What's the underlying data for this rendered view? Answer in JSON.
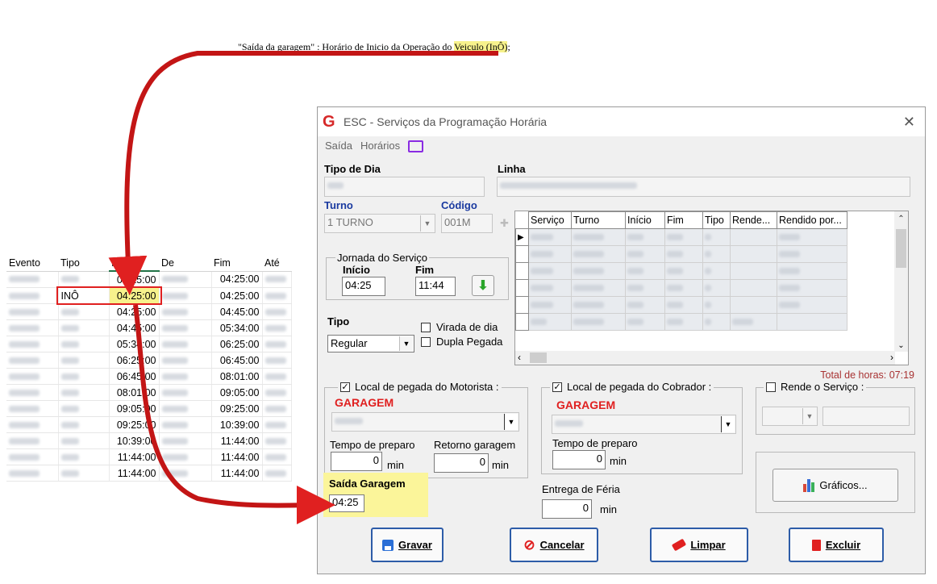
{
  "annotation": {
    "prefix": "\"Saída da garagem\" : Horário de Inicio da Operação do ",
    "highlight": "Veiculo (InÔ)",
    "suffix": ";"
  },
  "sheet": {
    "headers": [
      "Evento",
      "Tipo",
      "Início",
      "De",
      "Fim",
      "Até"
    ],
    "rows": [
      {
        "tipo": "",
        "inicio": "04:25:00",
        "fim": "04:25:00"
      },
      {
        "tipo": "INÔ",
        "inicio": "04:25:00",
        "fim": "04:25:00"
      },
      {
        "tipo": "",
        "inicio": "04:25:00",
        "fim": "04:45:00"
      },
      {
        "tipo": "",
        "inicio": "04:45:00",
        "fim": "05:34:00"
      },
      {
        "tipo": "",
        "inicio": "05:34:00",
        "fim": "06:25:00"
      },
      {
        "tipo": "",
        "inicio": "06:25:00",
        "fim": "06:45:00"
      },
      {
        "tipo": "",
        "inicio": "06:45:00",
        "fim": "08:01:00"
      },
      {
        "tipo": "",
        "inicio": "08:01:00",
        "fim": "09:05:00"
      },
      {
        "tipo": "",
        "inicio": "09:05:00",
        "fim": "09:25:00"
      },
      {
        "tipo": "",
        "inicio": "09:25:00",
        "fim": "10:39:00"
      },
      {
        "tipo": "",
        "inicio": "10:39:00",
        "fim": "11:44:00"
      },
      {
        "tipo": "",
        "inicio": "11:44:00",
        "fim": "11:44:00"
      },
      {
        "tipo": "",
        "inicio": "11:44:00",
        "fim": "11:44:00"
      }
    ]
  },
  "window": {
    "title": "ESC - Serviços da Programação Horária",
    "close": "✕",
    "menu": [
      "Saída",
      "Horários"
    ],
    "tipo_dia_label": "Tipo de Dia",
    "linha_label": "Linha",
    "turno_label": "Turno",
    "turno_value": "1 TURNO",
    "codigo_label": "Código",
    "codigo_value": "001M",
    "plus": "✚",
    "jornada_label": "Jornada do Serviço",
    "inicio_label": "Início",
    "inicio_value": "04:25",
    "fim_label": "Fim",
    "fim_value": "11:44",
    "tipo_label": "Tipo",
    "tipo_value": "Regular",
    "virada_label": "Virada de dia",
    "dupla_label": "Dupla Pegada",
    "grid_headers": [
      "Serviço",
      "Turno",
      "Início",
      "Fim",
      "Tipo",
      "Rende...",
      "Rendido por..."
    ],
    "total_horas": "Total de horas: 07:19",
    "motorista_label": "Local de pegada do Motorista :",
    "motorista_local": "GARAGEM",
    "cobrador_label": "Local de pegada do Cobrador :",
    "cobrador_local": "GARAGEM",
    "rende_label": "Rende o Serviço :",
    "tempo_preparo_label": "Tempo de preparo",
    "tempo_preparo_value": "0",
    "retorno_label": "Retorno garagem",
    "retorno_value": "0",
    "tempo_preparo2_label": "Tempo de preparo",
    "tempo_preparo2_value": "0",
    "min": "min",
    "entrega_label": "Entrega de Féria",
    "entrega_value": "0",
    "saida_garagem_label": "Saída Garagem",
    "saida_garagem_value": "04:25",
    "graficos_label": "Gráficos...",
    "buttons": {
      "gravar": "Gravar",
      "cancelar": "Cancelar",
      "limpar": "Limpar",
      "excluir": "Excluir"
    }
  },
  "colors": {
    "accent_red": "#e02020",
    "highlight": "#f7f28c",
    "button_border": "#2d5ca8"
  }
}
